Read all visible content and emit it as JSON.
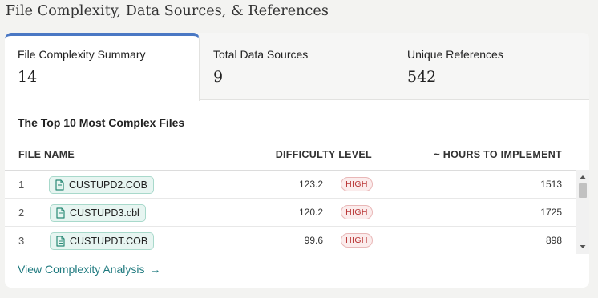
{
  "page": {
    "title": "File Complexity, Data Sources, & References"
  },
  "tabs": [
    {
      "label": "File Complexity Summary",
      "value": "14",
      "active": true
    },
    {
      "label": "Total Data Sources",
      "value": "9",
      "active": false
    },
    {
      "label": "Unique References",
      "value": "542",
      "active": false
    }
  ],
  "table": {
    "title": "The Top 10 Most Complex Files",
    "headers": {
      "file_name": "FILE NAME",
      "difficulty": "DIFFICULTY LEVEL",
      "hours": "~ HOURS TO IMPLEMENT"
    },
    "rows": [
      {
        "num": "1",
        "file": "CUSTUPD2.COB",
        "difficulty": "123.2",
        "level": "HIGH",
        "hours": "1513"
      },
      {
        "num": "2",
        "file": "CUSTUPD3.cbl",
        "difficulty": "120.2",
        "level": "HIGH",
        "hours": "1725"
      },
      {
        "num": "3",
        "file": "CUSTUPDT.COB",
        "difficulty": "99.6",
        "level": "HIGH",
        "hours": "898"
      }
    ]
  },
  "footer": {
    "link_label": "View Complexity Analysis",
    "link_arrow": "→"
  },
  "colors": {
    "accent": "#4a78c4",
    "link": "#1f7a7f",
    "chip_bg": "#e7f5f1",
    "chip_border": "#a8d9cb",
    "badge_text": "#b93535",
    "badge_bg": "#fbecec"
  },
  "icons": {
    "file": "file-document-icon",
    "arrow": "arrow-right-icon",
    "scroll_up": "chevron-up-icon",
    "scroll_down": "chevron-down-icon"
  }
}
